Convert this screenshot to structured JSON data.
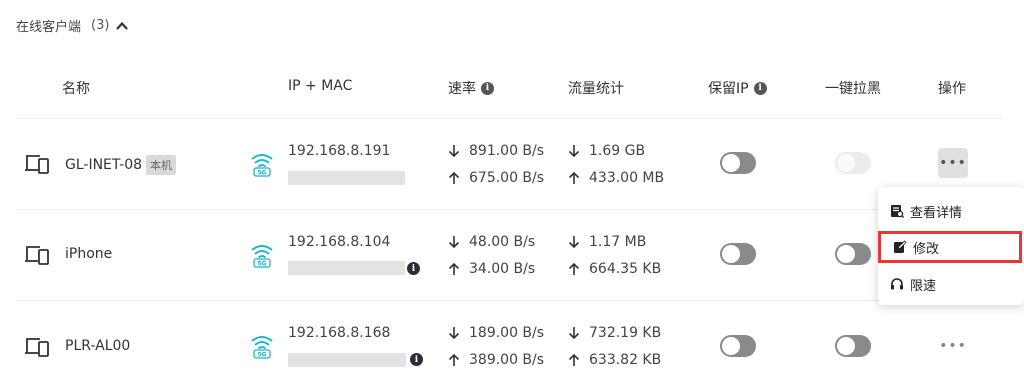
{
  "section": {
    "title": "在线客户端",
    "count": "(3)"
  },
  "columns": {
    "name": "名称",
    "ip_mac": "IP + MAC",
    "rate": "速率",
    "traffic": "流量统计",
    "reserve_ip": "保留IP",
    "block": "一键拉黑",
    "actions": "操作"
  },
  "clients": [
    {
      "name": "GL-INET-08",
      "badge": "本机",
      "band": "5G",
      "ip": "192.168.8.191",
      "rate_down": "891.00 B/s",
      "rate_up": "675.00 B/s",
      "traffic_down": "1.69 GB",
      "traffic_up": "433.00 MB",
      "reserve_ip": false,
      "block": false,
      "block_disabled": true,
      "more": "•••"
    },
    {
      "name": "iPhone",
      "badge": "",
      "band": "5G",
      "ip": "192.168.8.104",
      "rate_down": "48.00 B/s",
      "rate_up": "34.00 B/s",
      "traffic_down": "1.17 MB",
      "traffic_up": "664.35 KB",
      "reserve_ip": false,
      "block": false,
      "block_disabled": false,
      "more": "•••"
    },
    {
      "name": "PLR-AL00",
      "badge": "",
      "band": "5G",
      "ip": "192.168.8.168",
      "rate_down": "189.00 B/s",
      "rate_up": "389.00 B/s",
      "traffic_down": "732.19 KB",
      "traffic_up": "633.82 KB",
      "reserve_ip": false,
      "block": false,
      "block_disabled": false,
      "more": "•••"
    }
  ],
  "menu": {
    "details": "查看详情",
    "edit": "修改",
    "limit": "限速"
  },
  "colors": {
    "wifi": "#1fb5c9",
    "highlight_border": "#e53935",
    "toggle_off": "#8a8a8a"
  }
}
